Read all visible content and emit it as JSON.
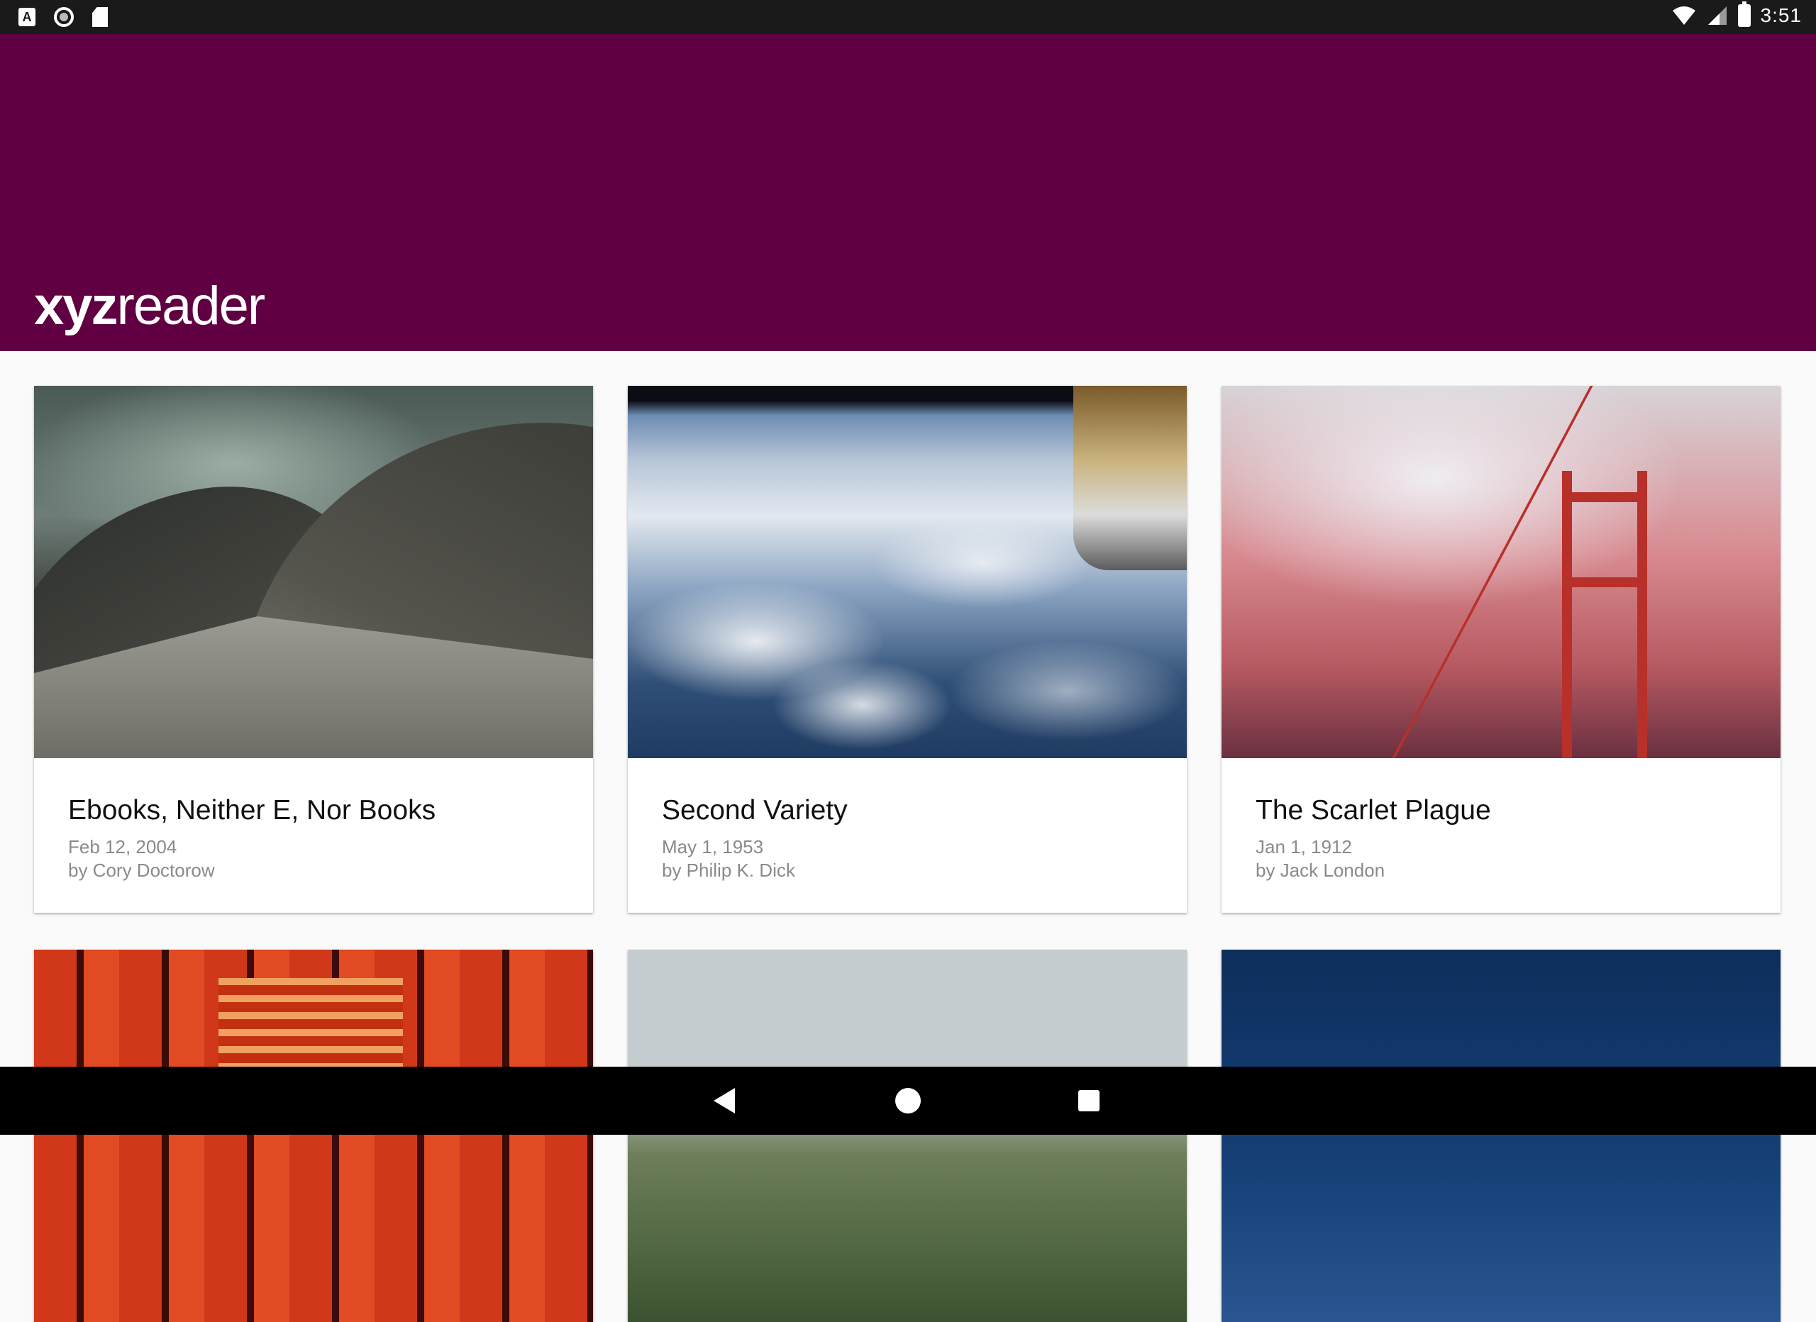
{
  "status_bar": {
    "time": "3:51",
    "left_icons": [
      "a-notification-icon",
      "circle-notification-icon",
      "sd-card-icon"
    ],
    "right_icons": [
      "wifi-icon",
      "cell-signal-icon",
      "battery-charging-icon"
    ]
  },
  "app_bar": {
    "logo_bold": "xyz",
    "logo_light": "reader",
    "color": "#600043"
  },
  "articles": [
    {
      "title": "Ebooks, Neither E, Nor Books",
      "date": "Feb 12, 2004",
      "author": "by Cory Doctorow",
      "image": "opera-house-photo"
    },
    {
      "title": "Second Variety",
      "date": "May 1, 1953",
      "author": "by Philip K. Dick",
      "image": "earth-from-space-photo"
    },
    {
      "title": "The Scarlet Plague",
      "date": "Jan 1, 1912",
      "author": "by Jack London",
      "image": "golden-gate-fog-photo"
    },
    {
      "title": "",
      "date": "",
      "author": "",
      "image": "torii-gates-photo"
    },
    {
      "title": "",
      "date": "",
      "author": "",
      "image": "forest-lake-photo"
    },
    {
      "title": "",
      "date": "",
      "author": "",
      "image": "blue-sky-photo"
    }
  ],
  "nav_bar": {
    "buttons": [
      "back-icon",
      "home-icon",
      "recents-icon"
    ]
  }
}
